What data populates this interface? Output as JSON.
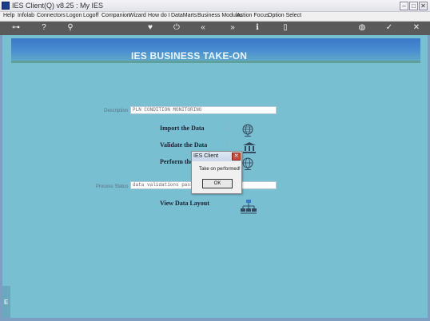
{
  "window": {
    "title": "IES Client(Q) v8.25 : My IES"
  },
  "menu": {
    "items": [
      "Help",
      "Infolab",
      "Connectors",
      "Logon",
      "Logoff",
      "Companion",
      "Wizard",
      "How do I",
      "DataMarts",
      "Business Modules",
      "Action Focus",
      "Option Select"
    ]
  },
  "toolbar": {
    "icons": [
      "key-icon",
      "help-icon",
      "search-icon",
      "heart-icon",
      "power-icon",
      "rewind-icon",
      "forward-icon",
      "info-icon",
      "page-icon",
      "globe-icon",
      "check-icon",
      "close-icon"
    ]
  },
  "header": {
    "title": "IES BUSINESS TAKE-ON"
  },
  "form": {
    "description_label": "Description",
    "description_value": "PLN CONDITION MONITORING",
    "process_status_label": "Process Status",
    "process_status_value": "data validations pass"
  },
  "actions": {
    "import": "Import the Data",
    "validate": "Validate the Data",
    "perform": "Perform the",
    "view_layout": "View Data Layout"
  },
  "dialog": {
    "title": "IES Client",
    "message": "Take on performed!",
    "ok_label": "OK"
  },
  "colors": {
    "accent": "#3a78c8",
    "client_bg": "#79bfd2",
    "toolbar_bg": "#5a5a5a"
  }
}
